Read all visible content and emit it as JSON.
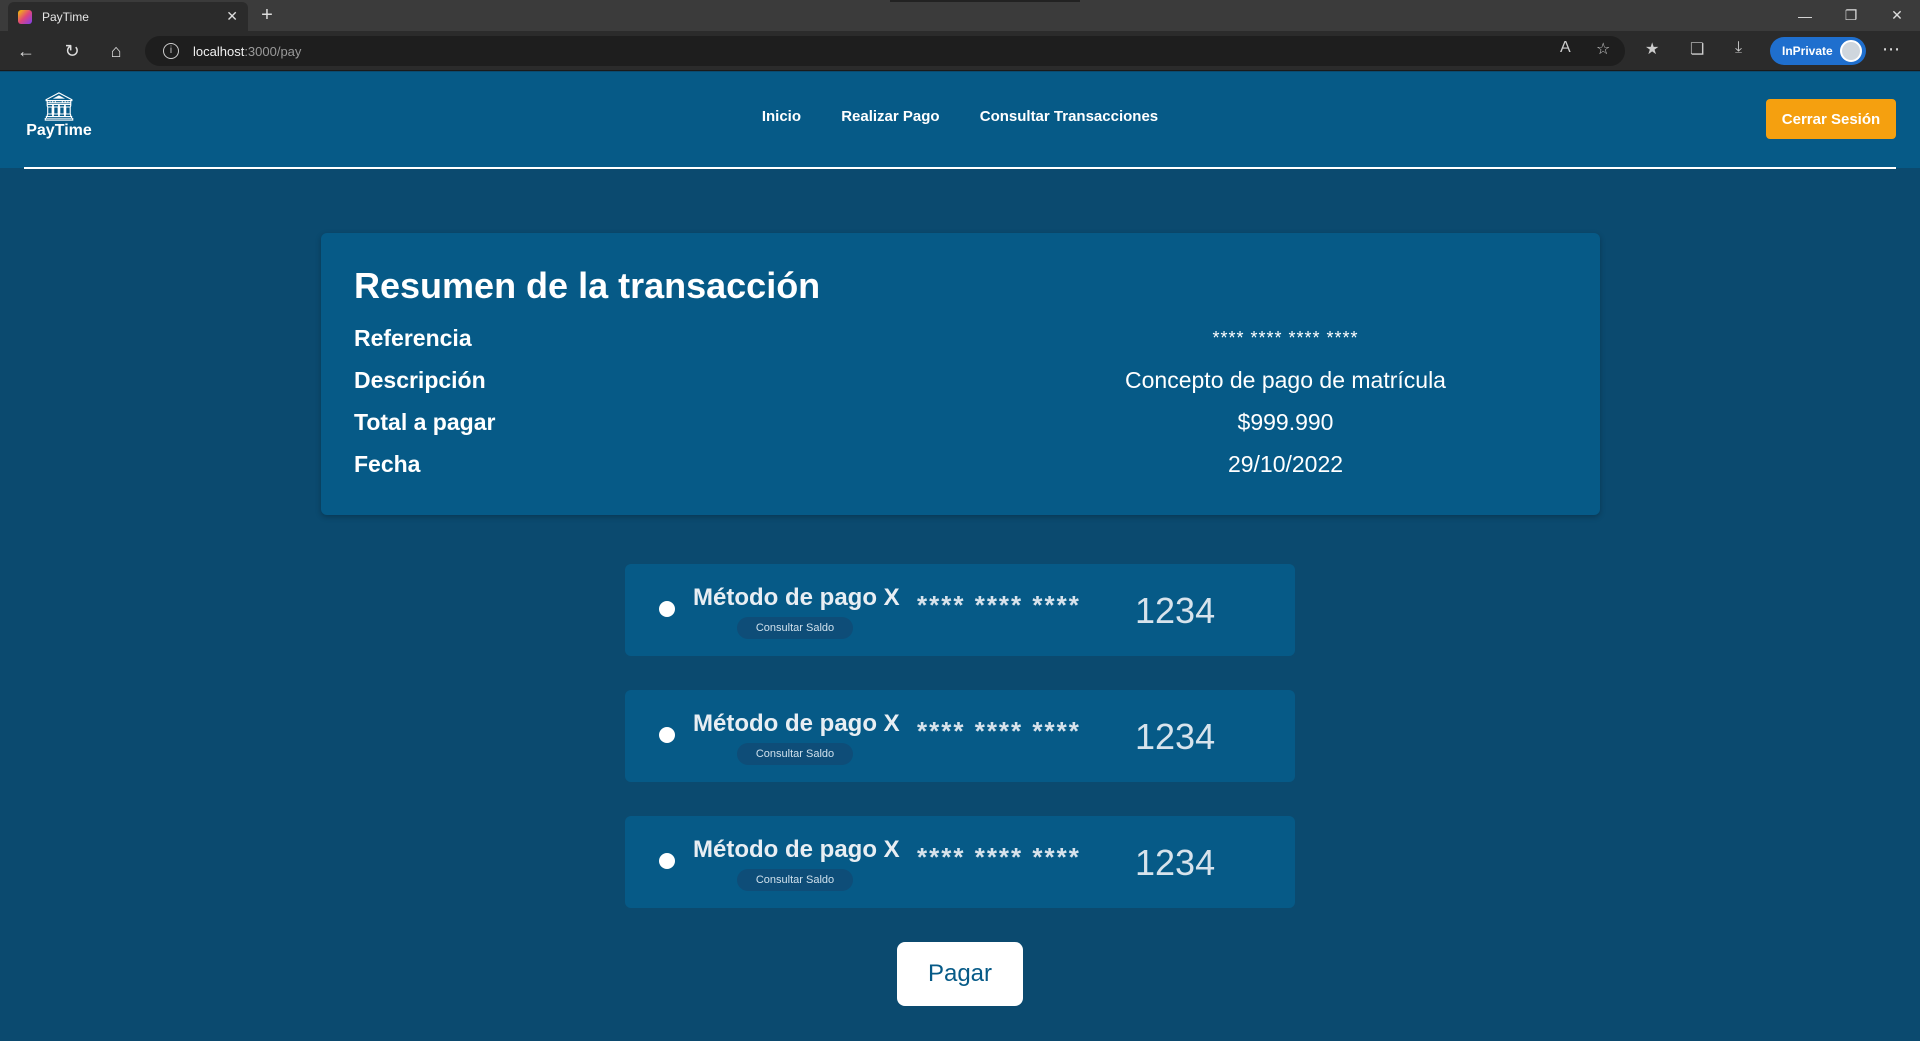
{
  "browser": {
    "tab_title": "PayTime",
    "url_host": "localhost",
    "url_path": ":3000/pay",
    "inprivate_label": "InPrivate"
  },
  "header": {
    "brand": "PayTime",
    "nav": [
      "Inicio",
      "Realizar Pago",
      "Consultar Transacciones"
    ],
    "logout_label": "Cerrar Sesión",
    "logout_color": "#f5a00f"
  },
  "summary": {
    "title": "Resumen de la transacción",
    "rows": [
      {
        "label": "Referencia",
        "value": "**** **** **** ****"
      },
      {
        "label": "Descripción",
        "value": "Concepto de pago de matrícula"
      },
      {
        "label": "Total a pagar",
        "value": "$999.990"
      },
      {
        "label": "Fecha",
        "value": "29/10/2022"
      }
    ]
  },
  "methods": [
    {
      "name": "Método de pago X",
      "saldo": "Consultar Saldo",
      "masked": "**** **** ****",
      "last4": "1234"
    },
    {
      "name": "Método de pago X",
      "saldo": "Consultar Saldo",
      "masked": "**** **** ****",
      "last4": "1234"
    },
    {
      "name": "Método de pago X",
      "saldo": "Consultar Saldo",
      "masked": "**** **** ****",
      "last4": "1234"
    }
  ],
  "pay_label": "Pagar",
  "colors": {
    "page_bg": "#0b4a6f",
    "card_bg": "#065a87",
    "accent": "#f5a00f"
  }
}
